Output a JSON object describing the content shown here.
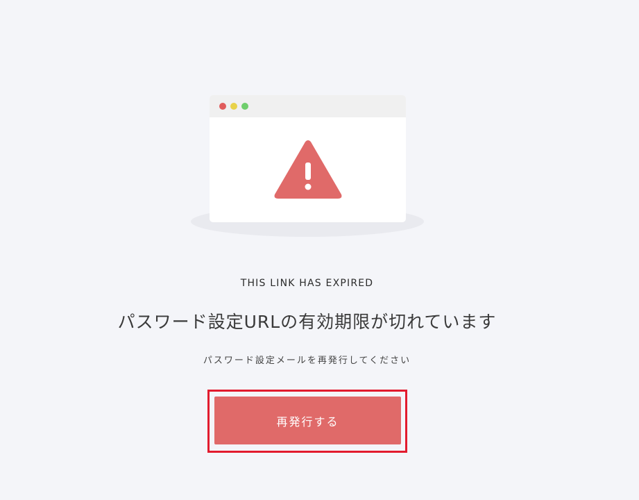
{
  "illustration": {
    "icon": "warning-triangle-icon",
    "window_dots": [
      "red",
      "yellow",
      "green"
    ],
    "colors": {
      "warning": "#e06a69",
      "dot_red": "#e05c5c",
      "dot_yellow": "#e8d24a",
      "dot_green": "#6fce6c"
    }
  },
  "message": {
    "subtitle": "THIS LINK HAS EXPIRED",
    "heading": "パスワード設定URLの有効期限が切れています",
    "instruction": "パスワード設定メールを再発行してください"
  },
  "actions": {
    "reissue_label": "再発行する"
  },
  "colors": {
    "background": "#f4f5f9",
    "button": "#e06a69",
    "highlight": "#e21b2e"
  }
}
